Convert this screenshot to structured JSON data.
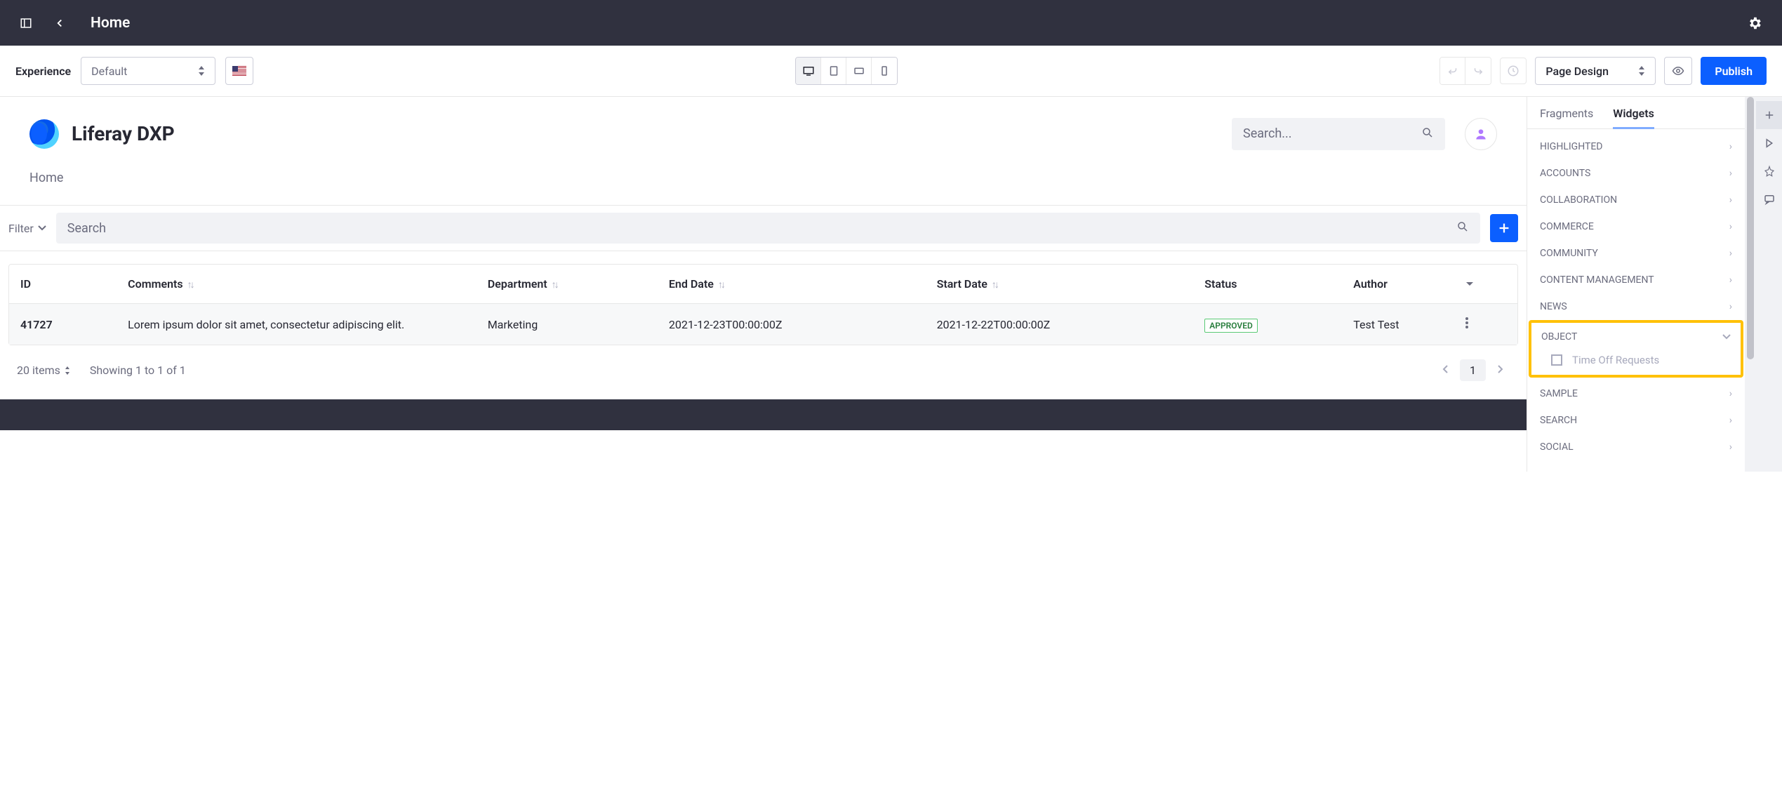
{
  "topHeader": {
    "title": "Home"
  },
  "toolbar": {
    "experienceLabel": "Experience",
    "experienceValue": "Default",
    "designModeValue": "Page Design",
    "publishLabel": "Publish"
  },
  "logoBar": {
    "appTitle": "Liferay DXP",
    "searchPlaceholder": "Search..."
  },
  "breadcrumb": "Home",
  "filterBar": {
    "filterLabel": "Filter",
    "searchPlaceholder": "Search"
  },
  "table": {
    "headers": {
      "id": "ID",
      "comments": "Comments",
      "department": "Department",
      "endDate": "End Date",
      "startDate": "Start Date",
      "status": "Status",
      "author": "Author"
    },
    "row": {
      "id": "41727",
      "comments": "Lorem ipsum dolor sit amet, consectetur adipiscing elit.",
      "department": "Marketing",
      "endDate": "2021-12-23T00:00:00Z",
      "startDate": "2021-12-22T00:00:00Z",
      "status": "APPROVED",
      "author": "Test Test"
    }
  },
  "pagination": {
    "pageSize": "20 items",
    "showing": "Showing 1 to 1 of 1",
    "page": "1"
  },
  "sidePanel": {
    "tabs": {
      "fragments": "Fragments",
      "widgets": "Widgets"
    },
    "categories": {
      "highlighted": "HIGHLIGHTED",
      "accounts": "ACCOUNTS",
      "collaboration": "COLLABORATION",
      "commerce": "COMMERCE",
      "community": "COMMUNITY",
      "contentManagement": "CONTENT MANAGEMENT",
      "news": "NEWS",
      "object": "OBJECT",
      "sample": "SAMPLE",
      "search": "SEARCH",
      "social": "SOCIAL"
    },
    "objectWidget": "Time Off Requests"
  }
}
